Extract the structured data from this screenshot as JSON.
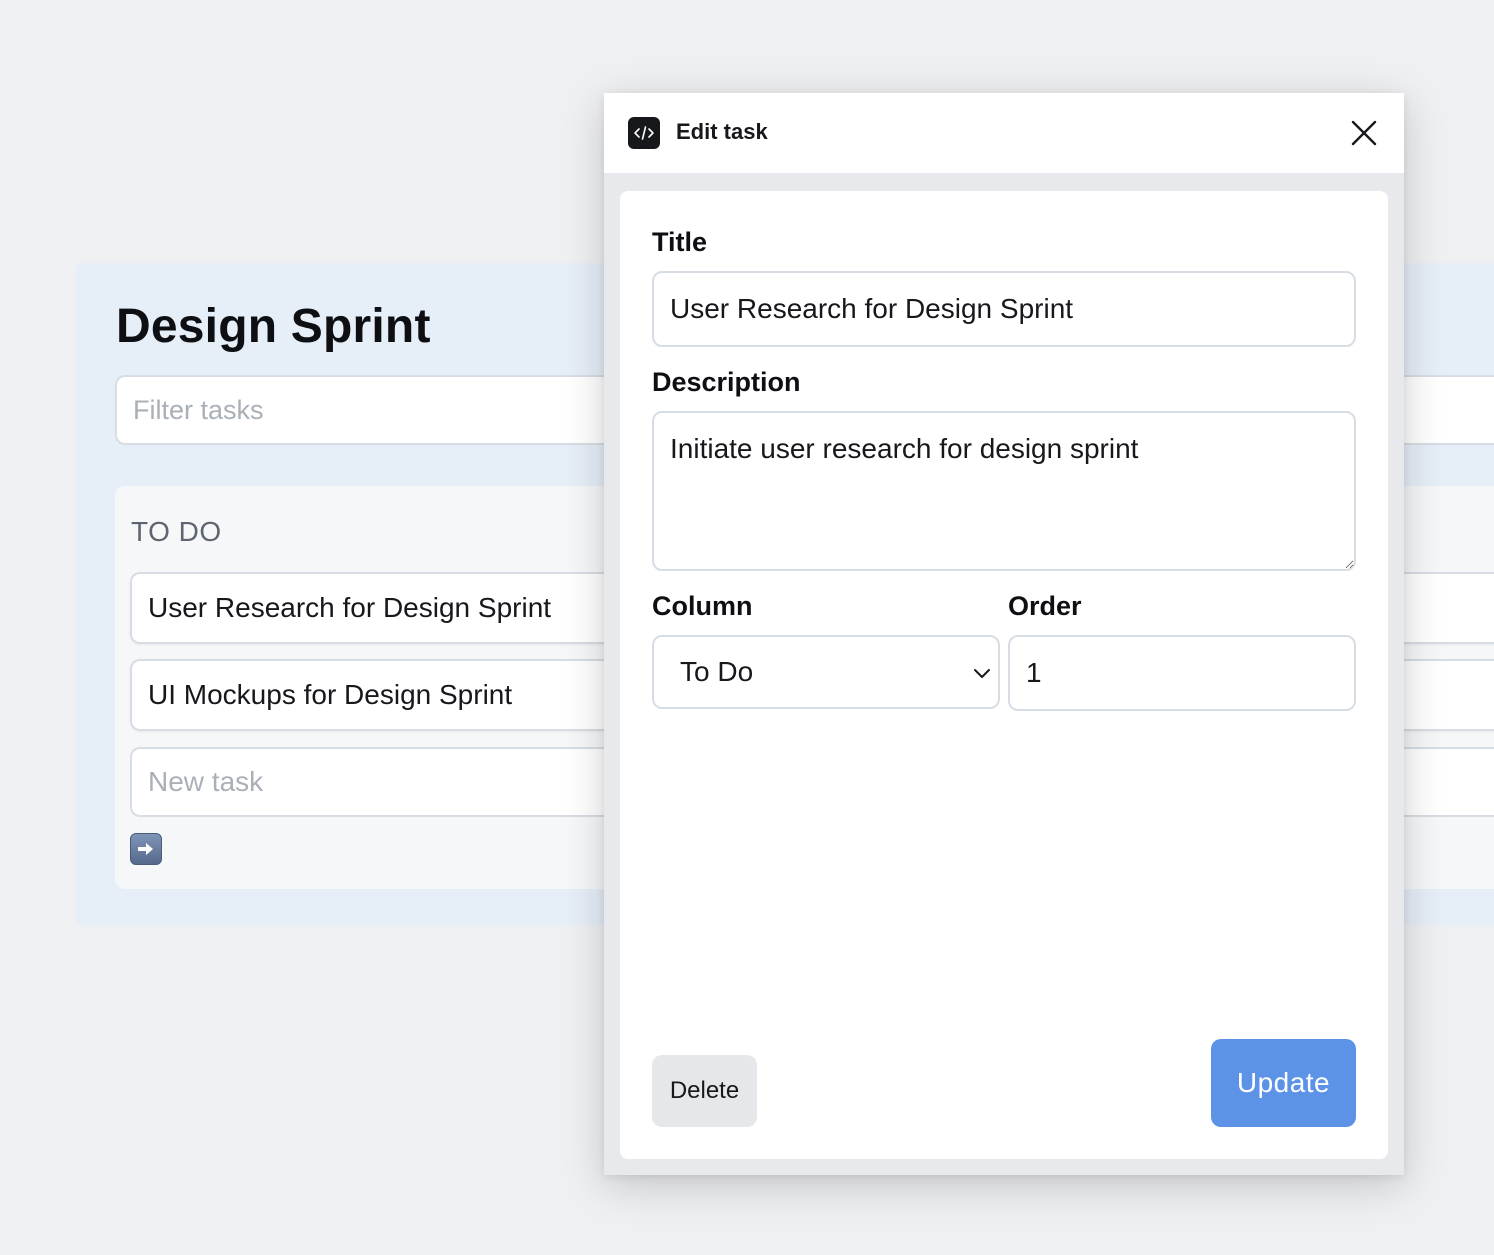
{
  "board": {
    "title": "Design Sprint",
    "filter_placeholder": "Filter tasks",
    "columns": [
      {
        "title": "TO DO",
        "tasks": [
          {
            "title": "User Research for Design Sprint"
          },
          {
            "title": "UI Mockups for Design Sprint"
          }
        ],
        "new_task_placeholder": "New task",
        "add_icon": "right-arrow-icon"
      }
    ]
  },
  "modal": {
    "app_icon": "code-icon",
    "title": "Edit task",
    "close_icon": "close-icon",
    "fields": {
      "title_label": "Title",
      "title_value": "User Research for Design Sprint",
      "description_label": "Description",
      "description_value": "Initiate user research for design sprint",
      "column_label": "Column",
      "column_value": "To Do",
      "order_label": "Order",
      "order_value": "1"
    },
    "delete_label": "Delete",
    "update_label": "Update"
  },
  "colors": {
    "page_background": "#eff0f2",
    "board_background": "#e6eef8",
    "update_button": "#5c93e6",
    "delete_button": "#e5e7ea"
  }
}
